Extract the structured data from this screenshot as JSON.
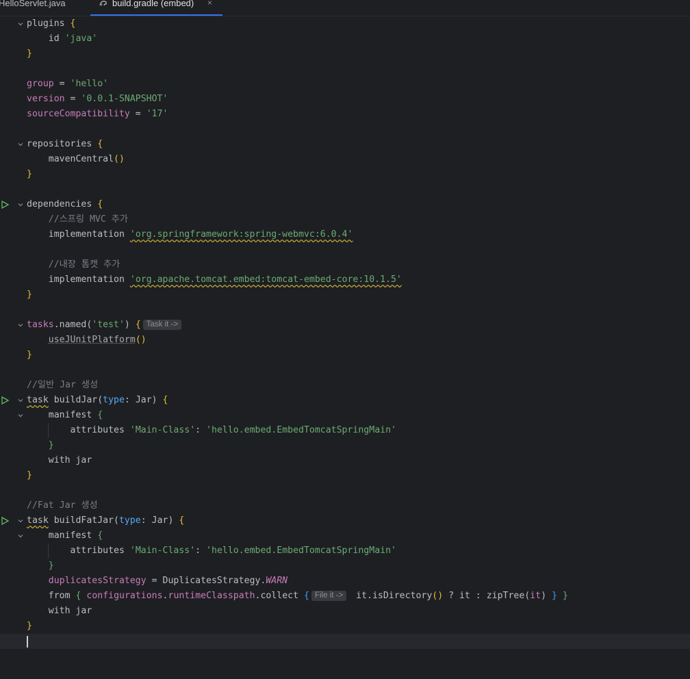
{
  "tabs": [
    {
      "label": "HelloServlet.java",
      "active": false
    },
    {
      "label": "build.gradle (embed)",
      "active": true,
      "close": "×"
    }
  ],
  "colors": {
    "accent": "#3574f0",
    "run_icon": "#5fb865"
  },
  "code": {
    "l1": [
      "plugins",
      "{"
    ],
    "l2": [
      "id",
      "'java'"
    ],
    "l3": [
      "}"
    ],
    "l5": [
      "group",
      " = ",
      "'hello'"
    ],
    "l6": [
      "version",
      " = ",
      "'0.0.1-SNAPSHOT'"
    ],
    "l7": [
      "sourceCompatibility",
      " = ",
      "'17'"
    ],
    "l9": [
      "repositories",
      "{"
    ],
    "l10": [
      "mavenCentral",
      "()"
    ],
    "l11": [
      "}"
    ],
    "l13": [
      "dependencies",
      "{"
    ],
    "l14": [
      "//스프링 MVC 추가"
    ],
    "l15": [
      "implementation",
      "'org.springframework:spring-webmvc:6.0.4'"
    ],
    "l17": [
      "//내장 톰캣 추가"
    ],
    "l18": [
      "implementation",
      "'org.apache.tomcat.embed:tomcat-embed-core:10.1.5'"
    ],
    "l19": [
      "}"
    ],
    "l21": [
      "tasks",
      ".named(",
      "'test'",
      ") ",
      "{",
      "Task it ->"
    ],
    "l22": [
      "useJUnitPlatform",
      "()"
    ],
    "l23": [
      "}"
    ],
    "l25": [
      "//일반 Jar 생성"
    ],
    "l26": [
      "task",
      " buildJar(",
      "type",
      ": Jar) ",
      "{"
    ],
    "l27": [
      "manifest",
      "{"
    ],
    "l28": [
      "attributes",
      "'Main-Class'",
      ": ",
      "'hello.embed.EmbedTomcatSpringMain'"
    ],
    "l29": [
      "}"
    ],
    "l30": [
      "with jar"
    ],
    "l31": [
      "}"
    ],
    "l33": [
      "//Fat Jar 생성"
    ],
    "l34": [
      "task",
      " buildFatJar(",
      "type",
      ": Jar) ",
      "{"
    ],
    "l35": [
      "manifest",
      "{"
    ],
    "l36": [
      "attributes",
      "'Main-Class'",
      ": ",
      "'hello.embed.EmbedTomcatSpringMain'"
    ],
    "l37": [
      "}"
    ],
    "l38": [
      "duplicatesStrategy",
      " = DuplicatesStrategy.",
      "WARN"
    ],
    "l39": [
      "from",
      "{",
      "configurations",
      ".",
      "runtimeClasspath",
      ".collect ",
      "{",
      "File it ->",
      " it.isDirectory",
      "()",
      " ? it : zipTree(",
      "it",
      ") ",
      "}",
      " }"
    ],
    "l40": [
      "with jar"
    ],
    "l41": [
      "}"
    ]
  }
}
